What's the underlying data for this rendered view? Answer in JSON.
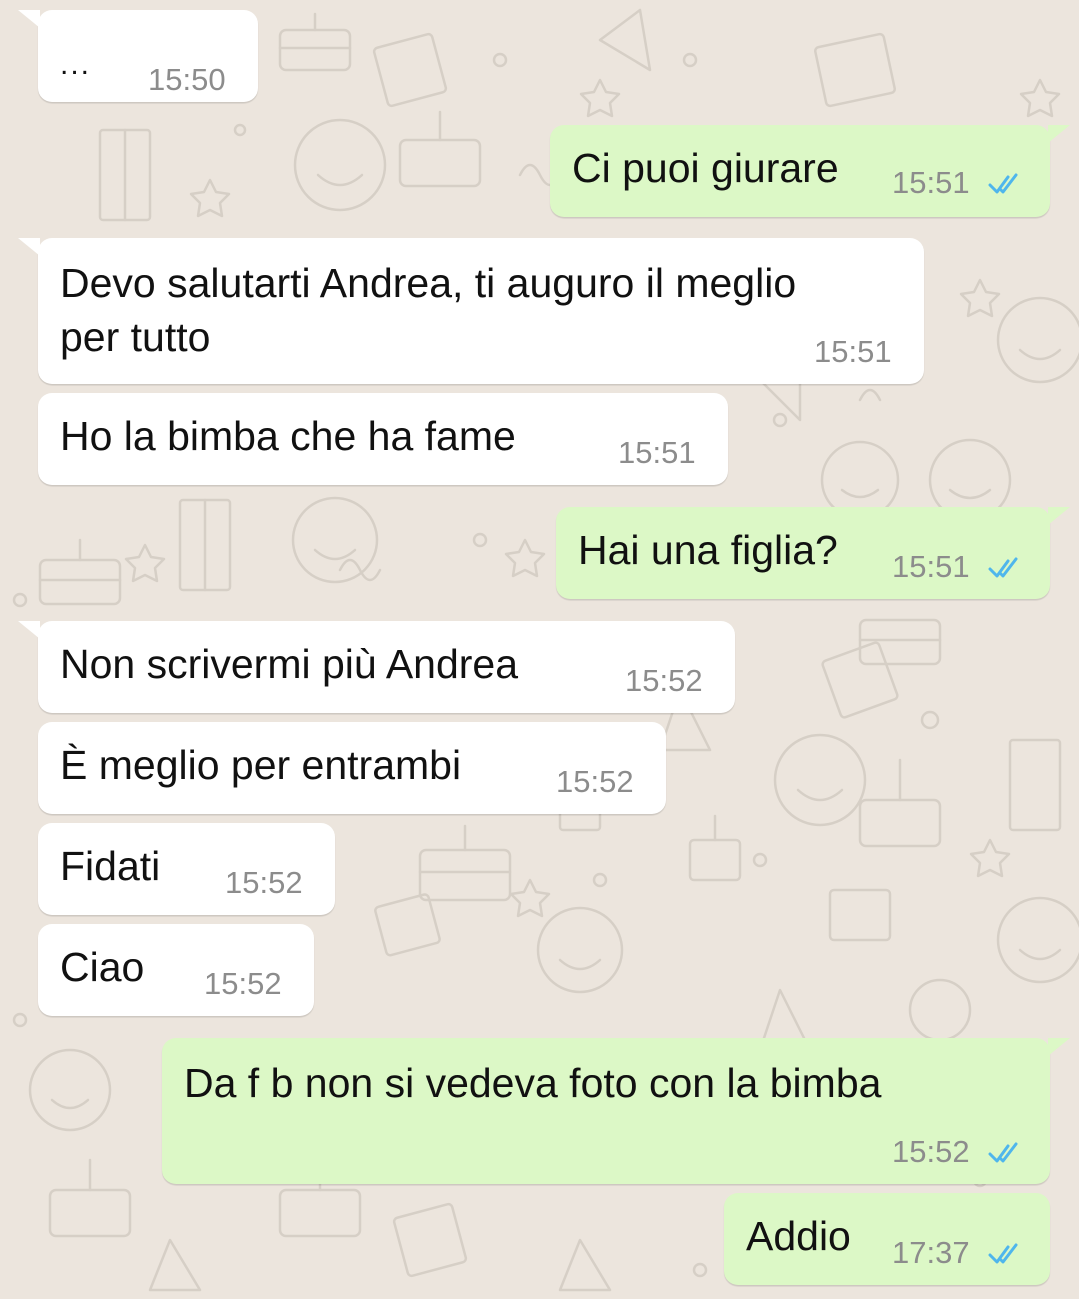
{
  "conversation": {
    "colors": {
      "incoming_bubble": "#ffffff",
      "outgoing_bubble": "#dcf8c6",
      "wallpaper": "#ece5dd",
      "read_ticks": "#4fb6ec",
      "timestamp": "#8c8c8c"
    },
    "messages": [
      {
        "direction": "incoming",
        "text": "...",
        "time": "15:50"
      },
      {
        "direction": "outgoing",
        "text": "Ci puoi giurare",
        "time": "15:51",
        "status": "read"
      },
      {
        "direction": "incoming",
        "text_line1": "Devo salutarti Andrea, ti auguro il meglio",
        "text_line2": "per tutto",
        "time": "15:51"
      },
      {
        "direction": "incoming",
        "text": "Ho la bimba che ha fame",
        "time": "15:51"
      },
      {
        "direction": "outgoing",
        "text": "Hai una figlia?",
        "time": "15:51",
        "status": "read"
      },
      {
        "direction": "incoming",
        "text": "Non scrivermi più Andrea",
        "time": "15:52"
      },
      {
        "direction": "incoming",
        "text": "È meglio per entrambi",
        "time": "15:52"
      },
      {
        "direction": "incoming",
        "text": "Fidati",
        "time": "15:52"
      },
      {
        "direction": "incoming",
        "text": "Ciao",
        "time": "15:52"
      },
      {
        "direction": "outgoing",
        "text": "Da f b non si vedeva foto con la bimba",
        "time": "15:52",
        "status": "read"
      },
      {
        "direction": "outgoing",
        "text": "Addio",
        "time": "17:37",
        "status": "read"
      }
    ]
  }
}
